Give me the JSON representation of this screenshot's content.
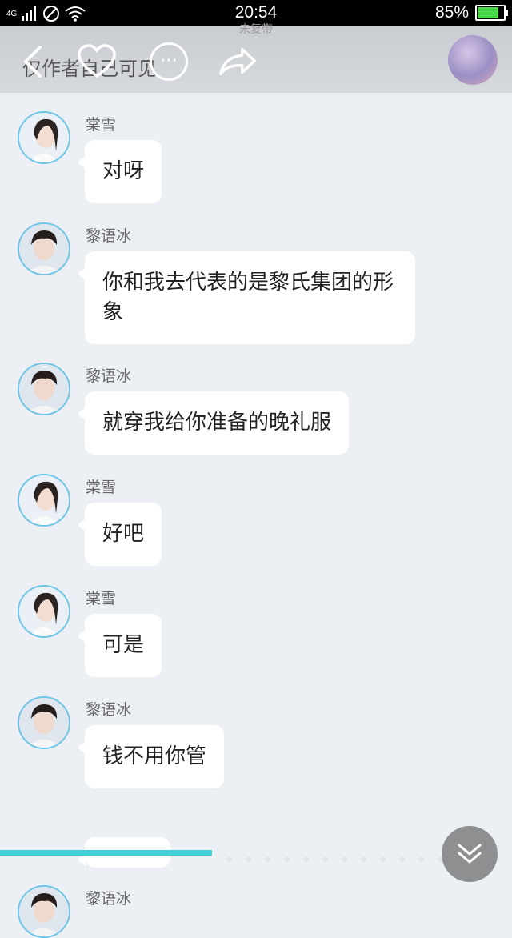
{
  "status": {
    "network": "4G",
    "time": "20:54",
    "battery": "85%",
    "battery_level": 0.85
  },
  "top_bar": {
    "subtitle": "未复带",
    "title": "仅作者自己可见"
  },
  "messages": [
    {
      "sender": "棠雪",
      "text": "对呀"
    },
    {
      "sender": "黎语冰",
      "text": "你和我去代表的是黎氏集团的形象"
    },
    {
      "sender": "黎语冰",
      "text": "就穿我给你准备的晚礼服"
    },
    {
      "sender": "棠雪",
      "text": "好吧"
    },
    {
      "sender": "棠雪",
      "text": "可是"
    },
    {
      "sender": "黎语冰",
      "text": "钱不用你管"
    },
    {
      "sender": "黎语冰",
      "text": ""
    }
  ],
  "icons": {
    "back": "back-arrow-icon",
    "like": "heart-icon",
    "more": "more-icon",
    "share": "share-icon",
    "scroll": "double-chevron-down-icon"
  }
}
